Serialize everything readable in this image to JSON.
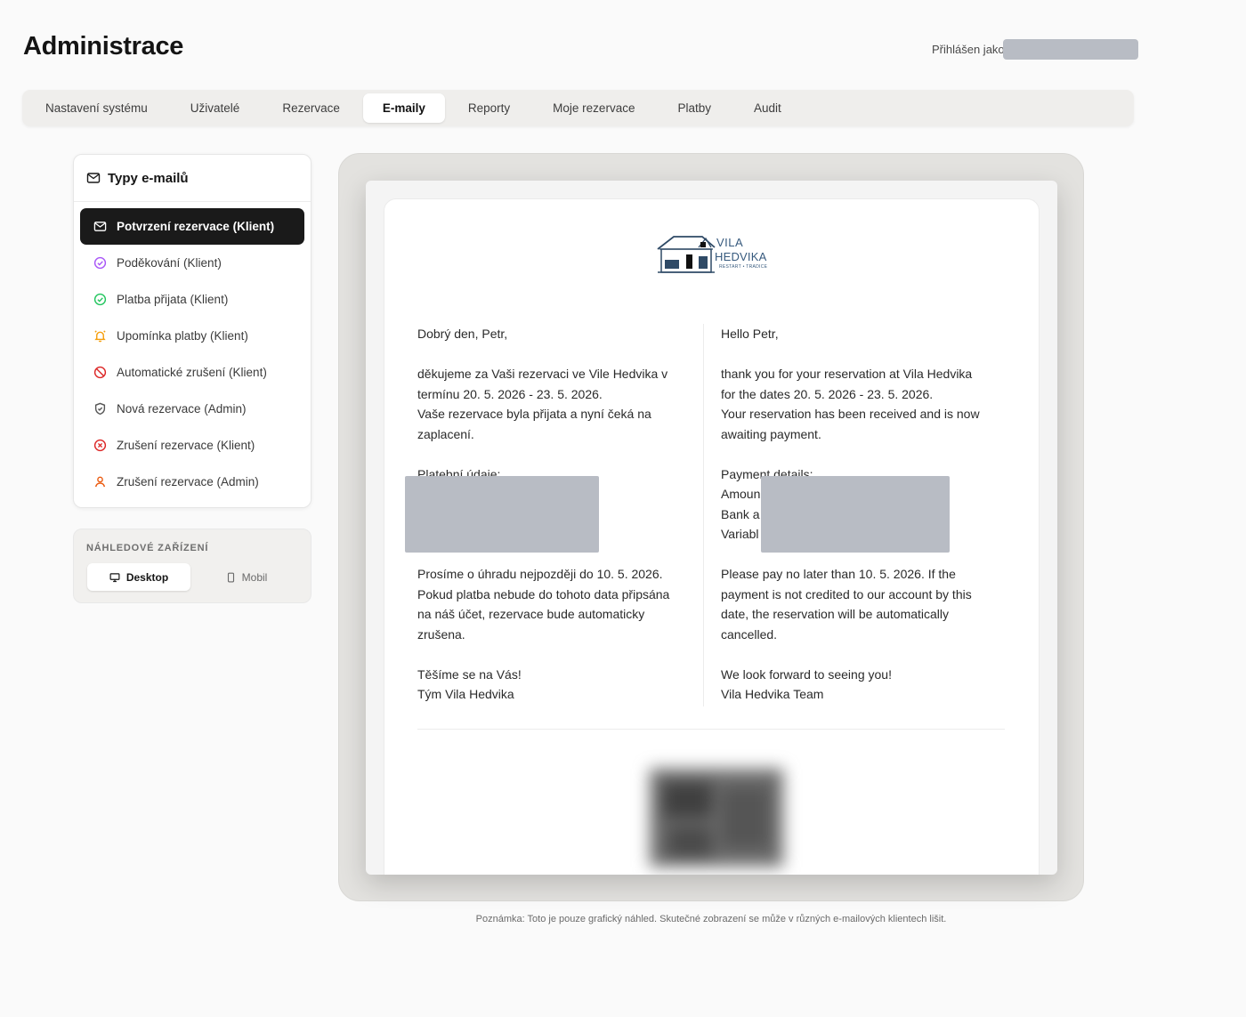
{
  "header": {
    "title": "Administrace",
    "logged_in_label": "Přihlášen jako"
  },
  "tabs": [
    {
      "label": "Nastavení systému"
    },
    {
      "label": "Uživatelé"
    },
    {
      "label": "Rezervace"
    },
    {
      "label": "E-maily",
      "active": true
    },
    {
      "label": "Reporty"
    },
    {
      "label": "Moje rezervace"
    },
    {
      "label": "Platby"
    },
    {
      "label": "Audit"
    }
  ],
  "sidebar": {
    "title": "Typy e-mailů",
    "items": [
      {
        "label": "Potvrzení rezervace (Klient)",
        "icon": "mail-icon",
        "active": true
      },
      {
        "label": "Poděkování (Klient)",
        "icon": "check-circle-icon",
        "color": "#a855f7"
      },
      {
        "label": "Platba přijata (Klient)",
        "icon": "check-circle-icon",
        "color": "#22c55e"
      },
      {
        "label": "Upomínka platby (Klient)",
        "icon": "bell-icon",
        "color": "#f59e0b"
      },
      {
        "label": "Automatické zrušení (Klient)",
        "icon": "ban-icon",
        "color": "#dc2626"
      },
      {
        "label": "Nová rezervace (Admin)",
        "icon": "shield-icon",
        "color": "#555555"
      },
      {
        "label": "Zrušení rezervace (Klient)",
        "icon": "x-circle-icon",
        "color": "#dc2626"
      },
      {
        "label": "Zrušení rezervace (Admin)",
        "icon": "user-icon",
        "color": "#ea580c"
      }
    ]
  },
  "device": {
    "label": "NÁHLEDOVÉ ZAŘÍZENÍ",
    "desktop": "Desktop",
    "mobile": "Mobil",
    "selected": "Desktop"
  },
  "email": {
    "logo": {
      "line1": "VILA",
      "line2": "HEDVIKA",
      "tagline": "RESTART • TRADICE"
    },
    "cz": {
      "greeting": "Dobrý den, Petr,",
      "p1a": "děkujeme za Vaši rezervaci ve Vile Hedvika v",
      "p1b": "termínu 20. 5. 2026 - 23. 5. 2026.",
      "p1c": "Vaše rezervace byla přijata a nyní čeká na",
      "p1d": "zaplacení.",
      "payment_heading": "Platební údaje:",
      "p2a": "Prosíme o úhradu nejpozději do 10. 5. 2026.",
      "p2b": "Pokud platba nebude do tohoto data připsána",
      "p2c": "na náš účet, rezervace bude automaticky",
      "p2d": "zrušena.",
      "closing": "Těšíme se na Vás!",
      "signature": "Tým Vila Hedvika"
    },
    "en": {
      "greeting": "Hello Petr,",
      "p1a": "thank you for your reservation at Vila Hedvika",
      "p1b": "for the dates 20. 5. 2026 - 23. 5. 2026.",
      "p1c": "Your reservation has been received and is now",
      "p1d": "awaiting payment.",
      "payment_heading": "Payment details:",
      "amount_label": "Amoun",
      "bank_label": "Bank a",
      "variable_label": "Variabl",
      "p2a": "Please pay no later than 10. 5. 2026. If the",
      "p2b": "payment is not credited to our account by this",
      "p2c": "date, the reservation will be automatically",
      "p2d": "cancelled.",
      "closing": "We look forward to seeing you!",
      "signature": "Vila Hedvika Team"
    }
  },
  "note": "Poznámka: Toto je pouze grafický náhled. Skutečné zobrazení se může v různých e-mailových klientech lišit."
}
